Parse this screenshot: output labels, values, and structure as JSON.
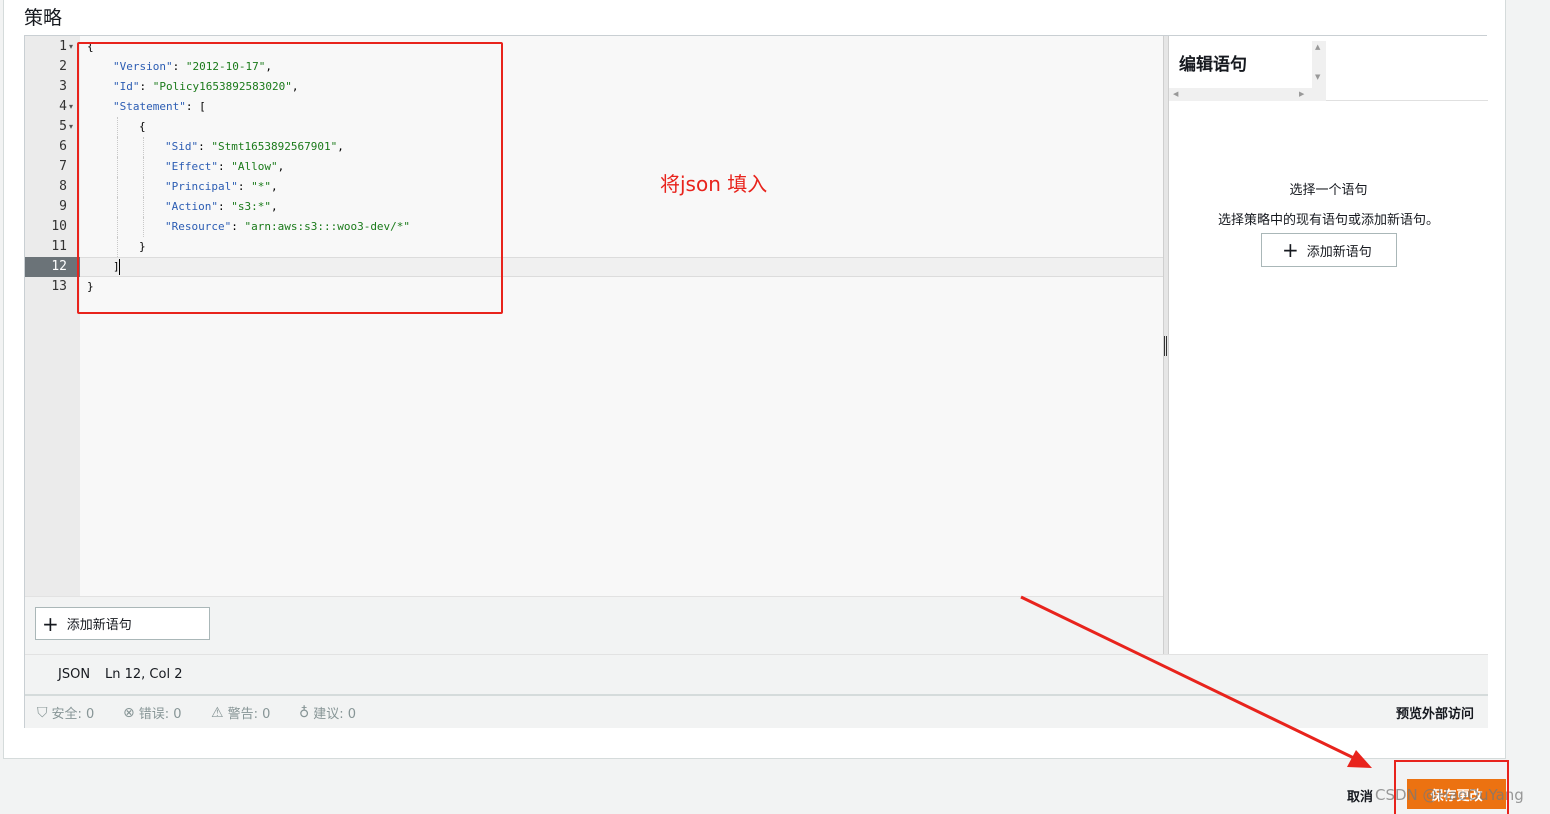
{
  "page": {
    "title": "策略"
  },
  "editor": {
    "lines": [
      {
        "num": "1",
        "indent": 0,
        "parts": [
          [
            "p",
            "{"
          ]
        ]
      },
      {
        "num": "2",
        "indent": 1,
        "parts": [
          [
            "k",
            "\"Version\""
          ],
          [
            "p",
            ": "
          ],
          [
            "s",
            "\"2012-10-17\""
          ],
          [
            "p",
            ","
          ]
        ]
      },
      {
        "num": "3",
        "indent": 1,
        "parts": [
          [
            "k",
            "\"Id\""
          ],
          [
            "p",
            ": "
          ],
          [
            "s",
            "\"Policy1653892583020\""
          ],
          [
            "p",
            ","
          ]
        ]
      },
      {
        "num": "4",
        "indent": 1,
        "parts": [
          [
            "k",
            "\"Statement\""
          ],
          [
            "p",
            ": ["
          ]
        ]
      },
      {
        "num": "5",
        "indent": 2,
        "parts": [
          [
            "p",
            "{"
          ]
        ]
      },
      {
        "num": "6",
        "indent": 3,
        "parts": [
          [
            "k",
            "\"Sid\""
          ],
          [
            "p",
            ": "
          ],
          [
            "s",
            "\"Stmt1653892567901\""
          ],
          [
            "p",
            ","
          ]
        ]
      },
      {
        "num": "7",
        "indent": 3,
        "parts": [
          [
            "k",
            "\"Effect\""
          ],
          [
            "p",
            ": "
          ],
          [
            "s",
            "\"Allow\""
          ],
          [
            "p",
            ","
          ]
        ]
      },
      {
        "num": "8",
        "indent": 3,
        "parts": [
          [
            "k",
            "\"Principal\""
          ],
          [
            "p",
            ": "
          ],
          [
            "s",
            "\"*\""
          ],
          [
            "p",
            ","
          ]
        ]
      },
      {
        "num": "9",
        "indent": 3,
        "parts": [
          [
            "k",
            "\"Action\""
          ],
          [
            "p",
            ": "
          ],
          [
            "s",
            "\"s3:*\""
          ],
          [
            "p",
            ","
          ]
        ]
      },
      {
        "num": "10",
        "indent": 3,
        "parts": [
          [
            "k",
            "\"Resource\""
          ],
          [
            "p",
            ": "
          ],
          [
            "s",
            "\"arn:aws:s3:::woo3-dev/*\""
          ]
        ]
      },
      {
        "num": "11",
        "indent": 2,
        "parts": [
          [
            "p",
            "}"
          ]
        ]
      },
      {
        "num": "12",
        "indent": 1,
        "parts": [
          [
            "p",
            "]"
          ]
        ]
      },
      {
        "num": "13",
        "indent": 0,
        "parts": [
          [
            "p",
            "}"
          ]
        ]
      }
    ],
    "active_line": "12",
    "fold_lines": [
      "1",
      "4",
      "5"
    ],
    "add_statement_label": "添加新语句"
  },
  "annotation": {
    "text": "将json 填入"
  },
  "side_panel": {
    "title": "编辑语句",
    "empty_title": "选择一个语句",
    "empty_desc": "选择策略中的现有语句或添加新语句。",
    "add_button_label": "添加新语句"
  },
  "status": {
    "language": "JSON",
    "position": "Ln 12, Col 2"
  },
  "issues": [
    {
      "icon": "shield-icon",
      "glyph": "⛉",
      "label": "安全: 0"
    },
    {
      "icon": "error-icon",
      "glyph": "⊗",
      "label": "错误: 0"
    },
    {
      "icon": "warning-icon",
      "glyph": "⚠",
      "label": "警告: 0"
    },
    {
      "icon": "lightbulb-icon",
      "glyph": "♁",
      "label": "建议: 0"
    }
  ],
  "preview_link": "预览外部访问",
  "footer": {
    "cancel_label": "取消",
    "save_label": "保存更改"
  },
  "watermark": "CSDN @HaoOuYang",
  "colors": {
    "accent": "#ec7211",
    "annotation_red": "#e8231c"
  }
}
